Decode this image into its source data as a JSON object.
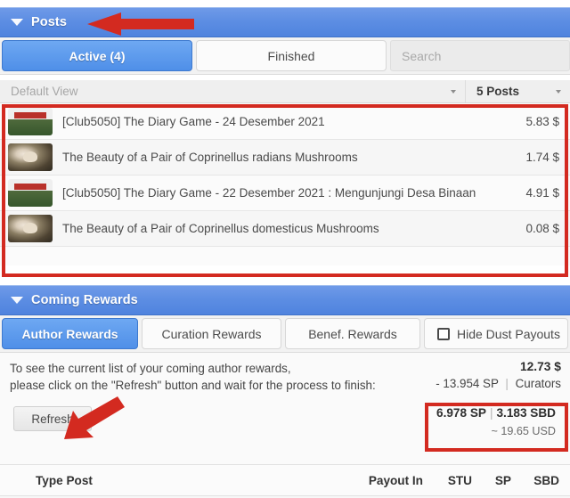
{
  "posts_panel": {
    "header_title": "Posts",
    "tabs": [
      {
        "label": "Active (4)",
        "active": true
      },
      {
        "label": "Finished",
        "active": false
      }
    ],
    "search_placeholder": "Search",
    "view_select": "Default View",
    "count_select": "5 Posts",
    "items": [
      {
        "title": "[Club5050] The Diary Game - 24 Desember 2021",
        "value": "5.83 $",
        "thumb": "diary"
      },
      {
        "title": "The Beauty of a Pair of Coprinellus radians Mushrooms",
        "value": "1.74 $",
        "thumb": "mush"
      },
      {
        "title": "[Club5050] The Diary Game - 22 Desember 2021 : Mengunjungi Desa Binaan",
        "value": "4.91 $",
        "thumb": "diary"
      },
      {
        "title": "The Beauty of a Pair of Coprinellus domesticus Mushrooms",
        "value": "0.08 $",
        "thumb": "mush"
      }
    ]
  },
  "rewards_panel": {
    "header_title": "Coming Rewards",
    "tabs": [
      {
        "label": "Author Rewards",
        "active": true
      },
      {
        "label": "Curation Rewards",
        "active": false
      },
      {
        "label": "Benef. Rewards",
        "active": false
      }
    ],
    "hide_dust_label": "Hide Dust Payouts",
    "info_line1": "To see the current list of your coming author rewards,",
    "info_line2": "please click on the \"Refresh\" button and wait for the process to finish:",
    "summary_amount": "12.73 $",
    "summary_sp": "- 13.954 SP",
    "summary_divider": "|",
    "summary_curators": "Curators",
    "refresh_label": "Refresh",
    "totals_sp": "6.978 SP",
    "totals_divider": "|",
    "totals_sbd": "3.183 SBD",
    "totals_usd": "~ 19.65 USD"
  },
  "table_header": {
    "type_post": "Type Post",
    "payout_in": "Payout In",
    "stu": "STU",
    "sp": "SP",
    "sbd": "SBD"
  },
  "colors": {
    "accent_blue": "#5d8ee3",
    "annotation_red": "#d32a20",
    "payout_green": "#2cb742"
  }
}
